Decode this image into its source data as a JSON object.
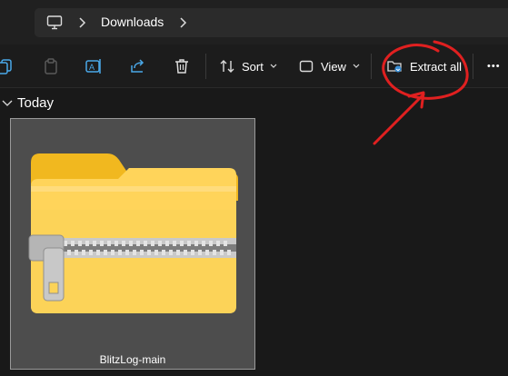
{
  "address_bar": {
    "location_icon": "computer-icon",
    "breadcrumb": "Downloads"
  },
  "toolbar": {
    "sort_label": "Sort",
    "view_label": "View",
    "extract_label": "Extract all",
    "more_label": "•••"
  },
  "content": {
    "group_header": "Today",
    "items": [
      {
        "name": "BlitzLog-main",
        "type": "compressed-folder",
        "selected": true
      }
    ]
  },
  "annotation": {
    "color": "#e02020"
  }
}
